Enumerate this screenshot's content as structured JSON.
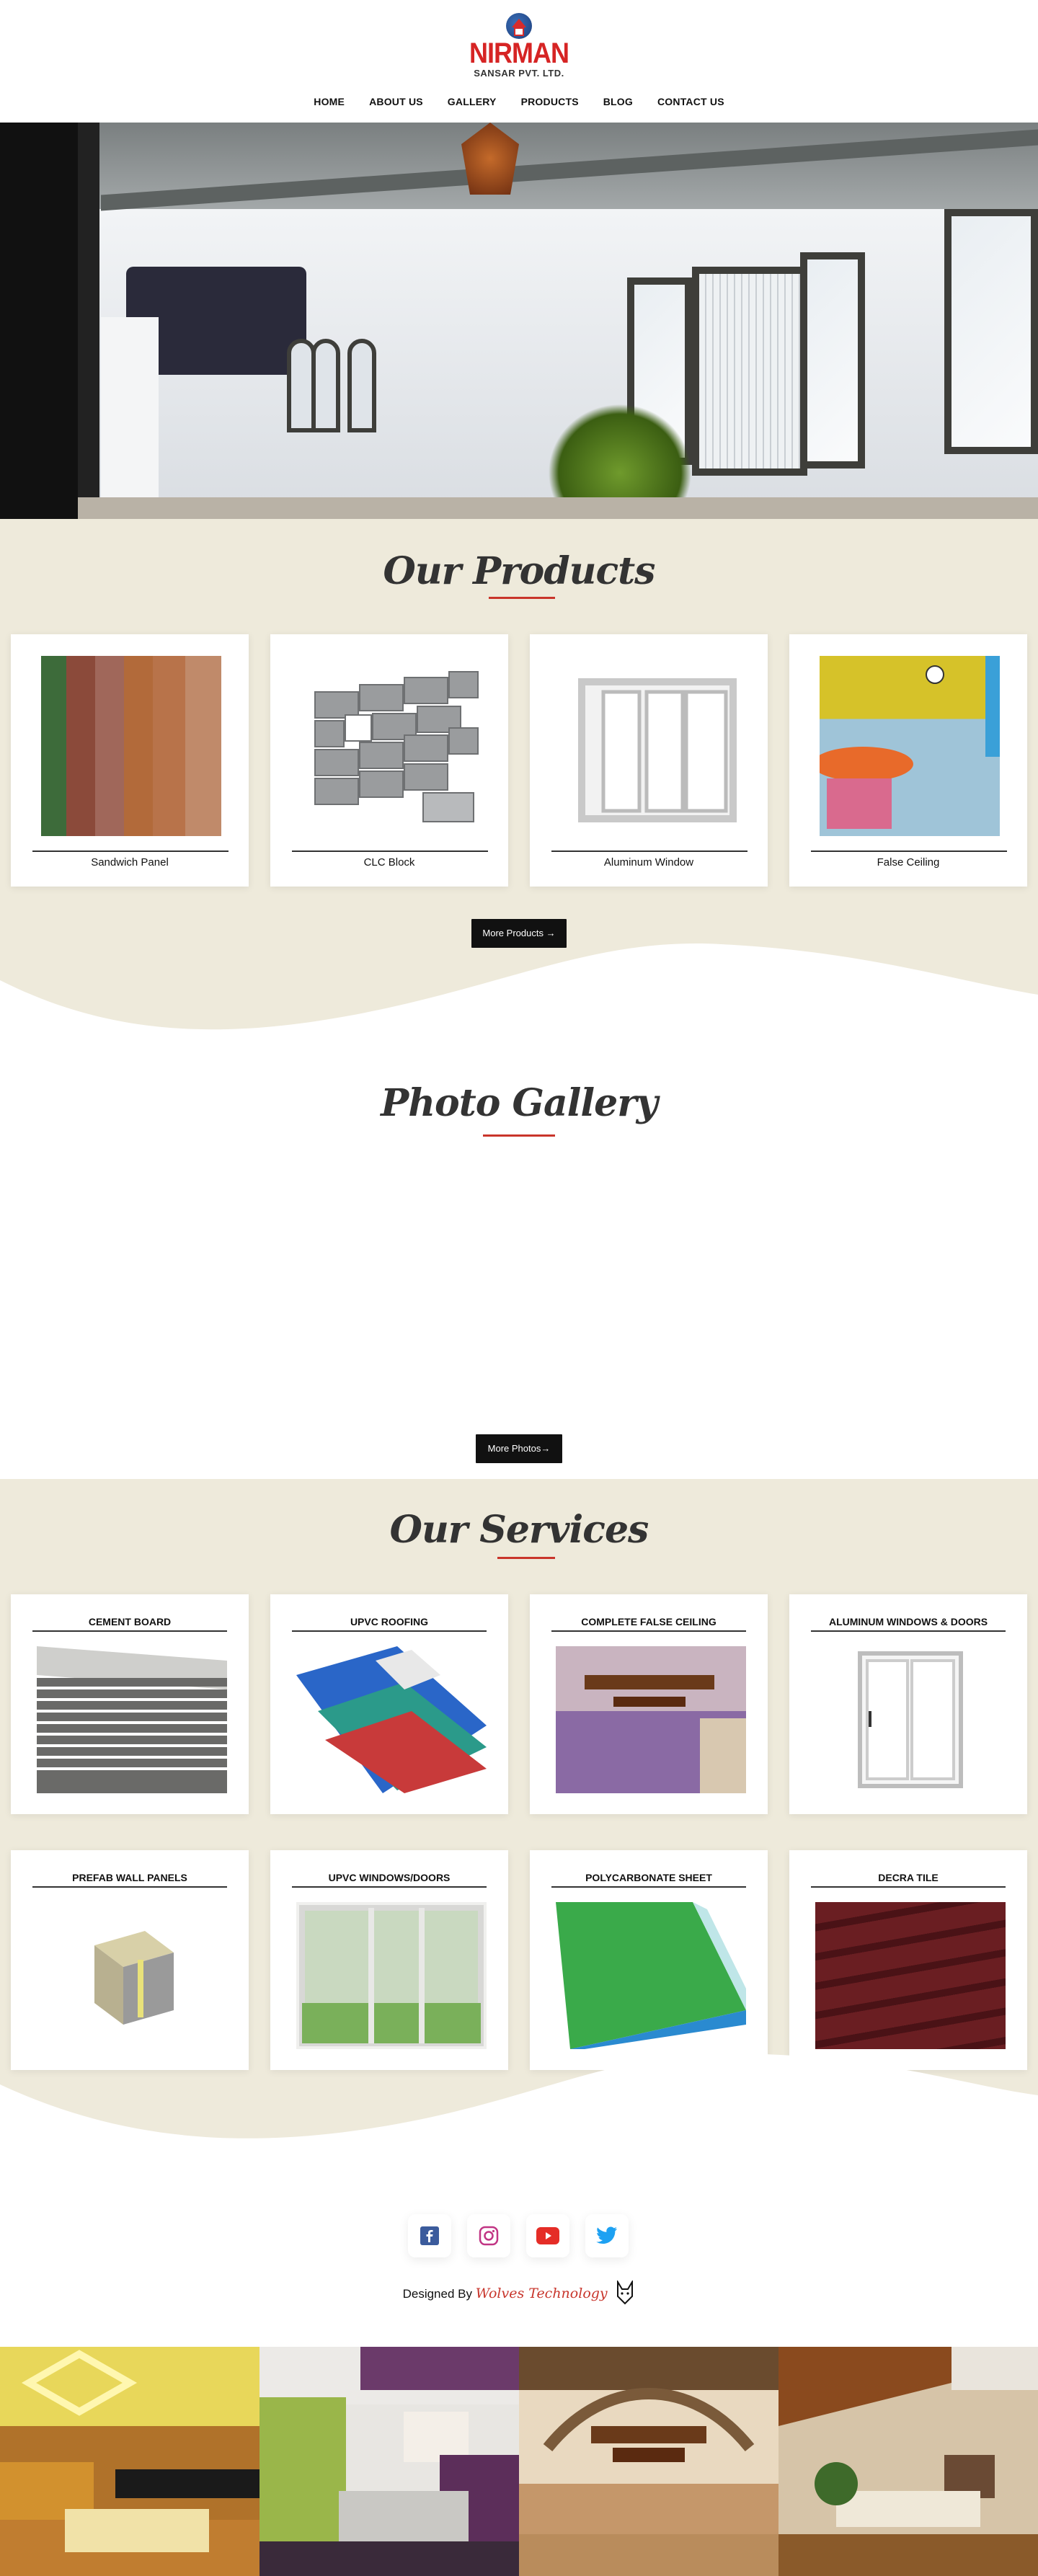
{
  "header": {
    "logo_name": "NIRMAN",
    "logo_sub": "SANSAR PVT. LTD.",
    "nav": [
      "HOME",
      "ABOUT US",
      "GALLERY",
      "PRODUCTS",
      "BLOG",
      "CONTACT US"
    ]
  },
  "products": {
    "title": "Our Products",
    "items": [
      {
        "label": "Sandwich Panel",
        "image": "sandwich-panel-image"
      },
      {
        "label": "CLC Block",
        "image": "clc-block-image"
      },
      {
        "label": "Aluminum Window",
        "image": "aluminum-window-image"
      },
      {
        "label": "False Ceiling",
        "image": "false-ceiling-image"
      }
    ],
    "more_label": "More Products →"
  },
  "gallery": {
    "title": "Photo Gallery",
    "more_label": "More Photos→"
  },
  "services": {
    "title": "Our Services",
    "items": [
      {
        "label": "CEMENT BOARD"
      },
      {
        "label": "UPVC ROOFING"
      },
      {
        "label": "COMPLETE FALSE CEILING"
      },
      {
        "label": "ALUMINUM WINDOWS & DOORS"
      },
      {
        "label": "PREFAB WALL PANELS"
      },
      {
        "label": "UPVC WINDOWS/DOORS"
      },
      {
        "label": "POLYCARBONATE SHEET"
      },
      {
        "label": "DECRA TILE"
      }
    ]
  },
  "footer": {
    "social": [
      "facebook-icon",
      "instagram-icon",
      "youtube-icon",
      "twitter-icon"
    ],
    "designed_by": "Designed By",
    "brand": "Wolves Technology"
  },
  "colors": {
    "accent": "#c9352b",
    "section_bg": "#eeeadb",
    "button_bg": "#111111"
  }
}
